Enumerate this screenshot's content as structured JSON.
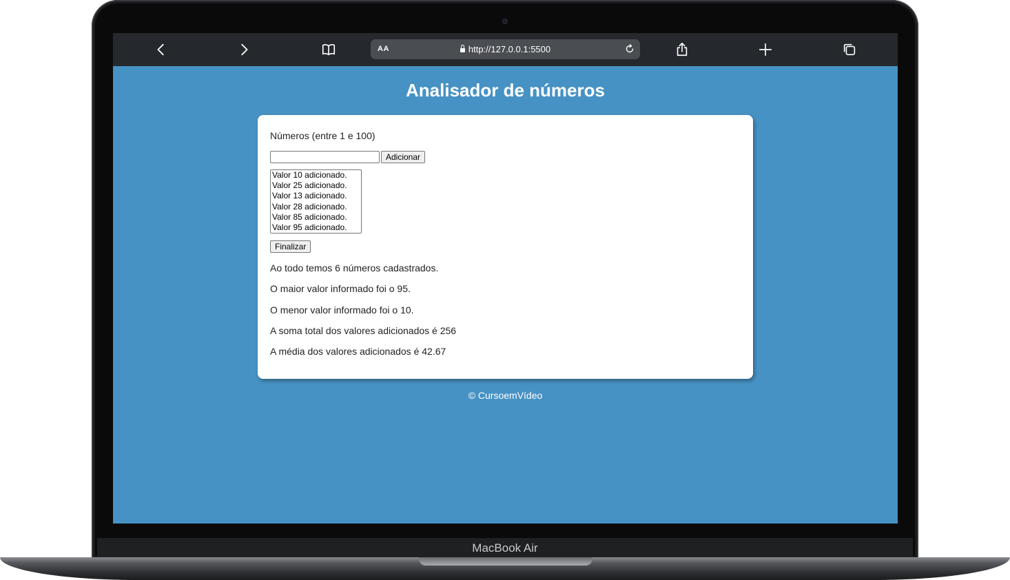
{
  "browser": {
    "text_size_label": "AA",
    "url": "http://127.0.0.1:5500",
    "icons": [
      "back-icon",
      "forward-icon",
      "bookmarks-icon",
      "lock-icon",
      "reload-icon",
      "share-icon",
      "new-tab-icon",
      "tabs-icon"
    ]
  },
  "page": {
    "title": "Analisador de números",
    "input_label": "Números (entre 1 e 100)",
    "input_value": "",
    "add_button": "Adicionar",
    "list_items": [
      "Valor 10 adicionado.",
      "Valor 25 adicionado.",
      "Valor 13 adicionado.",
      "Valor 28 adicionado.",
      "Valor 85 adicionado.",
      "Valor 95 adicionado."
    ],
    "finish_button": "Finalizar",
    "results": [
      "Ao todo temos 6 números cadastrados.",
      "O maior valor informado foi o 95.",
      "O menor valor informado foi o 10.",
      "A soma total dos valores adicionados é 256",
      "A média dos valores adicionados é 42.67"
    ],
    "footer": "© CursoemVídeo"
  },
  "device": {
    "label": "MacBook Air"
  },
  "colors": {
    "page_background": "#4792c4",
    "card_background": "#ffffff",
    "browser_bar": "#25282c"
  }
}
